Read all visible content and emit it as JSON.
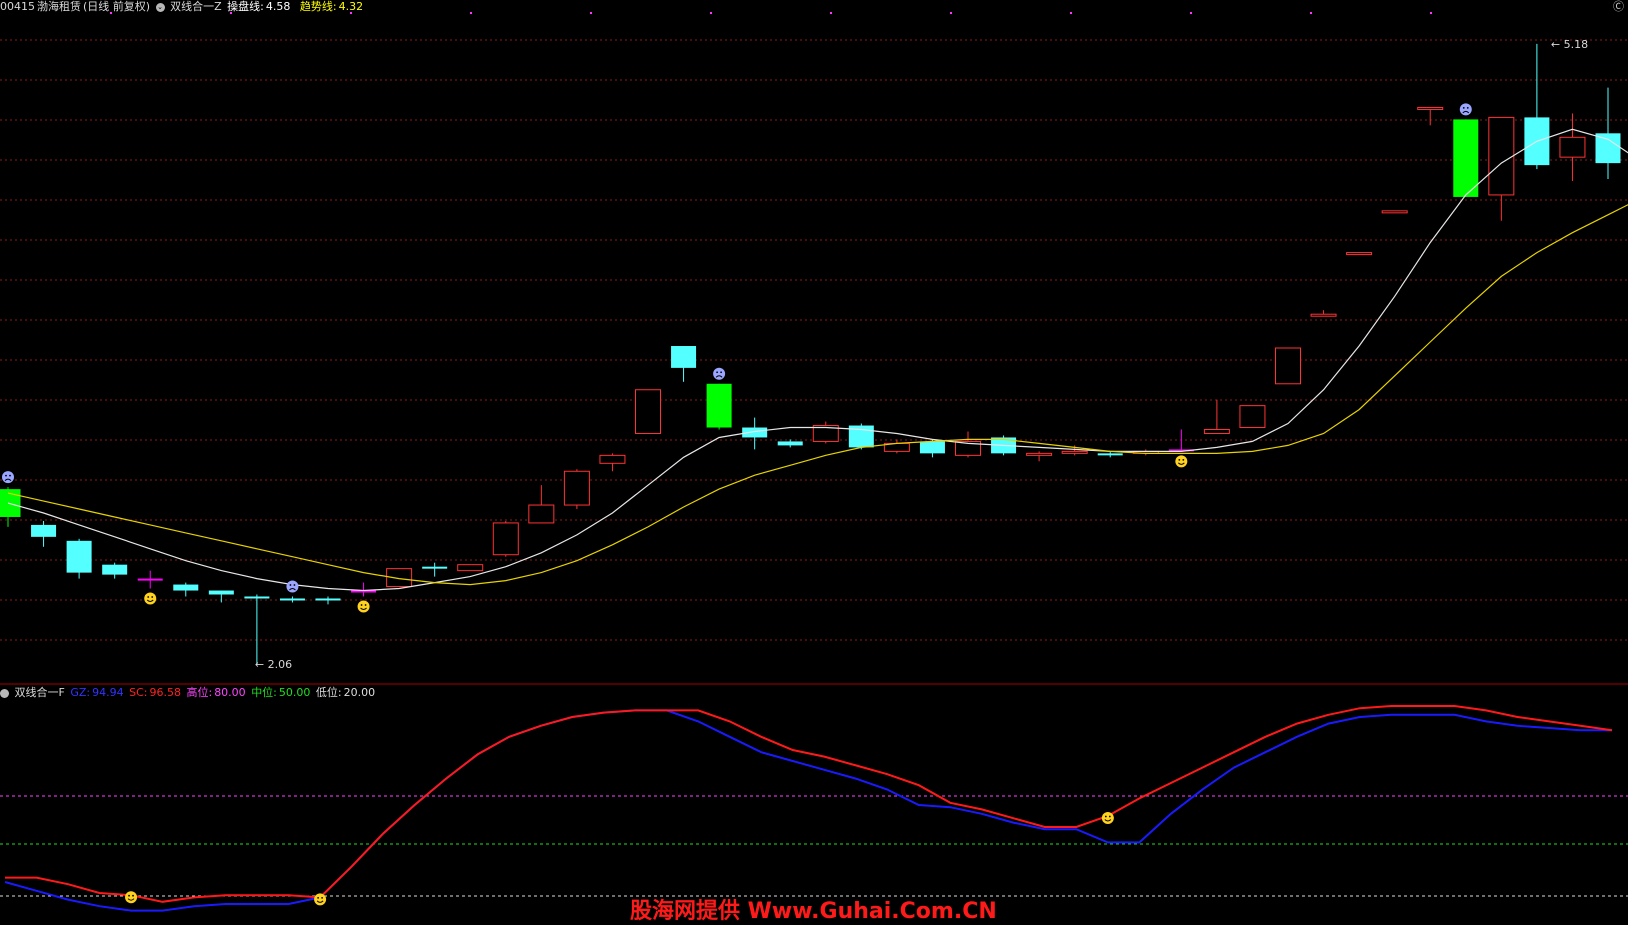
{
  "header": {
    "code": "00415",
    "name": "渤海租赁",
    "period": "(日线 前复权)",
    "indicator_name": "双线合一Z",
    "ctrl_label": "操盘线:",
    "ctrl_value": "4.58",
    "trend_label": "趋势线:",
    "trend_value": "4.32",
    "corner_label": "Ⓒ"
  },
  "sub": {
    "indicator_name": "双线合一F",
    "gz_label": "GZ:",
    "gz_value": "94.94",
    "sc_label": "SC:",
    "sc_value": "96.58",
    "high_label": "高位:",
    "high_value": "80.00",
    "mid_label": "中位:",
    "mid_value": "50.00",
    "low_label": "低位:",
    "low_value": "20.00"
  },
  "watermark": "股海网提供 Www.Guhai.Com.CN",
  "colors": {
    "up": "#ff3333",
    "down": "#54ffff",
    "strong_down": "#00ff00",
    "special": "#ff00ff",
    "ctrl_line": "#e6e6e6",
    "trend_line": "#e6d200",
    "gz_line": "#1a1aff",
    "sc_line": "#ff1a1a",
    "grid": "#8b1a1a",
    "sep": "#aa0000",
    "high_ref": "#ff44ff",
    "mid_ref": "#22dd22",
    "low_ref": "#dddddd"
  },
  "chart_data": [
    {
      "type": "candlestick",
      "title": "双线合一Z",
      "ylim": [
        2.0,
        5.3
      ],
      "high_label": "5.18",
      "low_label": "2.06",
      "candles": [
        {
          "o": 2.94,
          "h": 2.95,
          "l": 2.75,
          "c": 2.8,
          "k": "strong_down"
        },
        {
          "o": 2.76,
          "h": 2.78,
          "l": 2.65,
          "c": 2.7,
          "k": "down"
        },
        {
          "o": 2.68,
          "h": 2.69,
          "l": 2.49,
          "c": 2.52,
          "k": "down"
        },
        {
          "o": 2.56,
          "h": 2.57,
          "l": 2.49,
          "c": 2.51,
          "k": "down"
        },
        {
          "o": 2.49,
          "h": 2.53,
          "l": 2.44,
          "c": 2.48,
          "k": "special"
        },
        {
          "o": 2.46,
          "h": 2.47,
          "l": 2.4,
          "c": 2.43,
          "k": "down"
        },
        {
          "o": 2.43,
          "h": 2.43,
          "l": 2.37,
          "c": 2.41,
          "k": "down"
        },
        {
          "o": 2.4,
          "h": 2.41,
          "l": 2.06,
          "c": 2.39,
          "k": "down"
        },
        {
          "o": 2.39,
          "h": 2.4,
          "l": 2.37,
          "c": 2.39,
          "k": "down"
        },
        {
          "o": 2.39,
          "h": 2.4,
          "l": 2.36,
          "c": 2.38,
          "k": "down"
        },
        {
          "o": 2.43,
          "h": 2.47,
          "l": 2.4,
          "c": 2.43,
          "k": "special"
        },
        {
          "o": 2.45,
          "h": 2.54,
          "l": 2.45,
          "c": 2.54,
          "k": "up"
        },
        {
          "o": 2.55,
          "h": 2.57,
          "l": 2.5,
          "c": 2.54,
          "k": "down"
        },
        {
          "o": 2.53,
          "h": 2.56,
          "l": 2.53,
          "c": 2.56,
          "k": "up"
        },
        {
          "o": 2.61,
          "h": 2.78,
          "l": 2.6,
          "c": 2.77,
          "k": "up"
        },
        {
          "o": 2.77,
          "h": 2.96,
          "l": 2.77,
          "c": 2.86,
          "k": "up"
        },
        {
          "o": 2.86,
          "h": 3.04,
          "l": 2.84,
          "c": 3.03,
          "k": "up"
        },
        {
          "o": 3.11,
          "h": 3.12,
          "l": 3.03,
          "c": 3.07,
          "k": "up"
        },
        {
          "o": 3.22,
          "h": 3.44,
          "l": 3.22,
          "c": 3.44,
          "k": "up"
        },
        {
          "o": 3.66,
          "h": 3.66,
          "l": 3.48,
          "c": 3.55,
          "k": "down"
        },
        {
          "o": 3.47,
          "h": 3.47,
          "l": 3.24,
          "c": 3.25,
          "k": "strong_down"
        },
        {
          "o": 3.25,
          "h": 3.3,
          "l": 3.14,
          "c": 3.2,
          "k": "down"
        },
        {
          "o": 3.18,
          "h": 3.19,
          "l": 3.15,
          "c": 3.16,
          "k": "down"
        },
        {
          "o": 3.18,
          "h": 3.28,
          "l": 3.17,
          "c": 3.26,
          "k": "up"
        },
        {
          "o": 3.26,
          "h": 3.27,
          "l": 3.14,
          "c": 3.15,
          "k": "down"
        },
        {
          "o": 3.13,
          "h": 3.19,
          "l": 3.12,
          "c": 3.17,
          "k": "up"
        },
        {
          "o": 3.18,
          "h": 3.19,
          "l": 3.1,
          "c": 3.12,
          "k": "down"
        },
        {
          "o": 3.11,
          "h": 3.23,
          "l": 3.1,
          "c": 3.18,
          "k": "up"
        },
        {
          "o": 3.2,
          "h": 3.21,
          "l": 3.11,
          "c": 3.12,
          "k": "down"
        },
        {
          "o": 3.11,
          "h": 3.13,
          "l": 3.08,
          "c": 3.12,
          "k": "up"
        },
        {
          "o": 3.12,
          "h": 3.16,
          "l": 3.11,
          "c": 3.13,
          "k": "up"
        },
        {
          "o": 3.12,
          "h": 3.13,
          "l": 3.1,
          "c": 3.12,
          "k": "down"
        },
        {
          "o": 3.12,
          "h": 3.14,
          "l": 3.11,
          "c": 3.13,
          "k": "up"
        },
        {
          "o": 3.14,
          "h": 3.24,
          "l": 3.13,
          "c": 3.14,
          "k": "special"
        },
        {
          "o": 3.22,
          "h": 3.39,
          "l": 3.22,
          "c": 3.24,
          "k": "up"
        },
        {
          "o": 3.25,
          "h": 3.35,
          "l": 3.25,
          "c": 3.36,
          "k": "up"
        },
        {
          "o": 3.47,
          "h": 3.6,
          "l": 3.47,
          "c": 3.65,
          "k": "up"
        },
        {
          "o": 3.82,
          "h": 3.84,
          "l": 4.04,
          "c": 3.81,
          "k": "up"
        },
        {
          "o": 4.12,
          "h": 4.13,
          "l": 4.12,
          "c": 4.13,
          "k": "up"
        },
        {
          "o": 4.33,
          "h": 4.34,
          "l": 4.33,
          "c": 4.34,
          "k": "up"
        },
        {
          "o": 4.86,
          "h": 4.86,
          "l": 4.77,
          "c": 4.86,
          "k": "up"
        },
        {
          "o": 4.8,
          "h": 4.8,
          "l": 4.41,
          "c": 4.41,
          "k": "strong_down"
        },
        {
          "o": 4.42,
          "h": 4.42,
          "l": 4.29,
          "c": 4.81,
          "k": "up"
        },
        {
          "o": 4.81,
          "h": 5.18,
          "l": 4.55,
          "c": 4.57,
          "k": "down"
        },
        {
          "o": 4.61,
          "h": 4.83,
          "l": 4.49,
          "c": 4.71,
          "k": "up"
        },
        {
          "o": 4.73,
          "h": 4.96,
          "l": 4.5,
          "c": 4.58,
          "k": "down"
        }
      ],
      "series": [
        {
          "name": "操盘线",
          "values": [
            2.87,
            2.82,
            2.76,
            2.7,
            2.64,
            2.58,
            2.53,
            2.49,
            2.46,
            2.44,
            2.43,
            2.44,
            2.47,
            2.5,
            2.55,
            2.62,
            2.71,
            2.82,
            2.96,
            3.1,
            3.2,
            3.23,
            3.25,
            3.25,
            3.24,
            3.22,
            3.19,
            3.17,
            3.16,
            3.15,
            3.14,
            3.13,
            3.13,
            3.13,
            3.15,
            3.18,
            3.27,
            3.44,
            3.66,
            3.91,
            4.18,
            4.42,
            4.58,
            4.69,
            4.75,
            4.7,
            4.58
          ]
        },
        {
          "name": "趋势线",
          "values": [
            2.92,
            2.88,
            2.84,
            2.8,
            2.76,
            2.72,
            2.68,
            2.64,
            2.6,
            2.56,
            2.52,
            2.49,
            2.47,
            2.46,
            2.48,
            2.52,
            2.58,
            2.66,
            2.75,
            2.85,
            2.94,
            3.01,
            3.06,
            3.11,
            3.15,
            3.17,
            3.18,
            3.19,
            3.19,
            3.17,
            3.15,
            3.13,
            3.12,
            3.12,
            3.12,
            3.13,
            3.16,
            3.22,
            3.34,
            3.51,
            3.68,
            3.85,
            4.01,
            4.13,
            4.23,
            4.32,
            4.41
          ]
        }
      ],
      "markers": [
        {
          "i": 0,
          "t": "sad"
        },
        {
          "i": 4,
          "t": "smile"
        },
        {
          "i": 8,
          "t": "sad"
        },
        {
          "i": 10,
          "t": "smile"
        },
        {
          "i": 20,
          "t": "sad"
        },
        {
          "i": 33,
          "t": "smile"
        },
        {
          "i": 41,
          "t": "sad"
        }
      ]
    },
    {
      "type": "line",
      "title": "双线合一F",
      "ylim": [
        0,
        100
      ],
      "levels": {
        "high": 80,
        "mid": 50,
        "low": 20
      },
      "series": [
        {
          "name": "GZ",
          "values": [
            20,
            16,
            12,
            9,
            7,
            7,
            9,
            10,
            10,
            10,
            13,
            27,
            42,
            55,
            67,
            78,
            86,
            91,
            95,
            97,
            98,
            98,
            93,
            86,
            79,
            75,
            71,
            67,
            62,
            55,
            54,
            51,
            47,
            44,
            44,
            38,
            38,
            51,
            62,
            72,
            79,
            86,
            92,
            95,
            96,
            96,
            96,
            93,
            91,
            90,
            89,
            89
          ]
        },
        {
          "name": "SC",
          "values": [
            22,
            22,
            19,
            15,
            14,
            11,
            13,
            14,
            14,
            14,
            13,
            27,
            42,
            55,
            67,
            78,
            86,
            91,
            95,
            97,
            98,
            98,
            98,
            93,
            86,
            80,
            77,
            73,
            69,
            64,
            56,
            53,
            49,
            45,
            45,
            50,
            58,
            65,
            72,
            79,
            86,
            92,
            96,
            99,
            100,
            100,
            100,
            98,
            95,
            93,
            91,
            89
          ]
        }
      ],
      "markers": [
        {
          "i": 4,
          "t": "smile"
        },
        {
          "i": 10,
          "t": "smile"
        },
        {
          "i": 35,
          "t": "smile"
        }
      ]
    }
  ]
}
